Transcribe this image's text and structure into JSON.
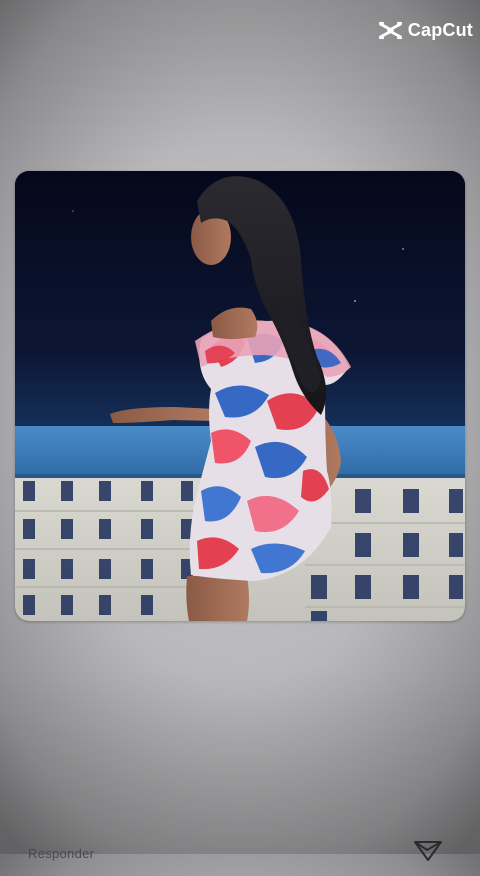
{
  "watermark": {
    "brand": "CapCut",
    "icon": "capcut-logo-icon"
  },
  "video": {
    "icon": "video-frame"
  },
  "bottom_bar": {
    "reply_label": "Responder",
    "send_icon": "paper-plane-icon"
  },
  "colors": {
    "background": "#bdbdbf",
    "sky": "#0a0f25",
    "wall_blue": "#3d7fbf",
    "wall_tiles": "#cfcfc9"
  }
}
